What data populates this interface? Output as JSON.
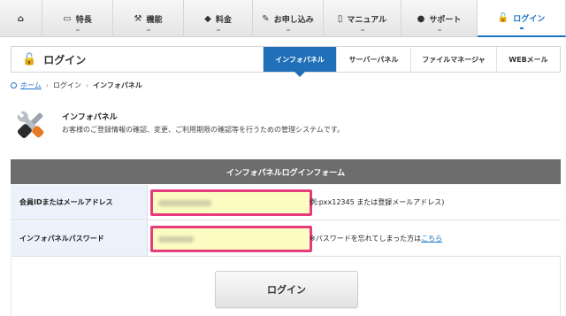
{
  "nav": {
    "items": [
      {
        "label": "",
        "icon": "home-icon",
        "glyph": "⌂",
        "width": 48
      },
      {
        "label": "特長",
        "icon": "monitor-icon",
        "glyph": "▭",
        "width": 80
      },
      {
        "label": "機能",
        "icon": "tools-icon",
        "glyph": "⚒",
        "width": 80
      },
      {
        "label": "料金",
        "icon": "tag-icon",
        "glyph": "◆",
        "width": 78
      },
      {
        "label": "お申し込み",
        "icon": "pencil-icon",
        "glyph": "✎",
        "width": 80
      },
      {
        "label": "マニュアル",
        "icon": "book-icon",
        "glyph": "▯",
        "width": 88
      },
      {
        "label": "サポート",
        "icon": "person-icon",
        "glyph": "●",
        "width": 86
      },
      {
        "label": "ログイン",
        "icon": "lock-icon",
        "glyph": "🔓",
        "width": 100,
        "active": true
      }
    ]
  },
  "titlebar": {
    "title": "ログイン",
    "tabs": [
      {
        "label": "インフォパネル",
        "active": true,
        "width": 83
      },
      {
        "label": "サーバーパネル",
        "width": 84
      },
      {
        "label": "ファイルマネージャ",
        "width": 97
      },
      {
        "label": "WEBメール",
        "width": 72
      }
    ]
  },
  "breadcrumb": {
    "home": "ホーム",
    "login": "ログイン",
    "current": "インフォパネル"
  },
  "intro": {
    "title": "インフォパネル",
    "description": "お客様のご登録情報の確認、変更、ご利用期限の確認等を行うための管理システムです。"
  },
  "form": {
    "heading": "インフォパネルログインフォーム",
    "id_label": "会員IDまたはメールアドレス",
    "id_hint": "例:pxx12345 または登録メールアドレス)",
    "password_label": "インフォパネルパスワード",
    "password_hint_prefix": "※パスワードを忘れてしまった方は",
    "password_hint_link": "こちら",
    "submit_label": "ログイン"
  },
  "colors": {
    "accent_blue": "#1f6fb9",
    "highlight_pink": "#e63c7e",
    "input_bg": "#fbfbc2",
    "label_bg": "#ebf2fb",
    "form_header_bg": "#6d6d6d"
  }
}
